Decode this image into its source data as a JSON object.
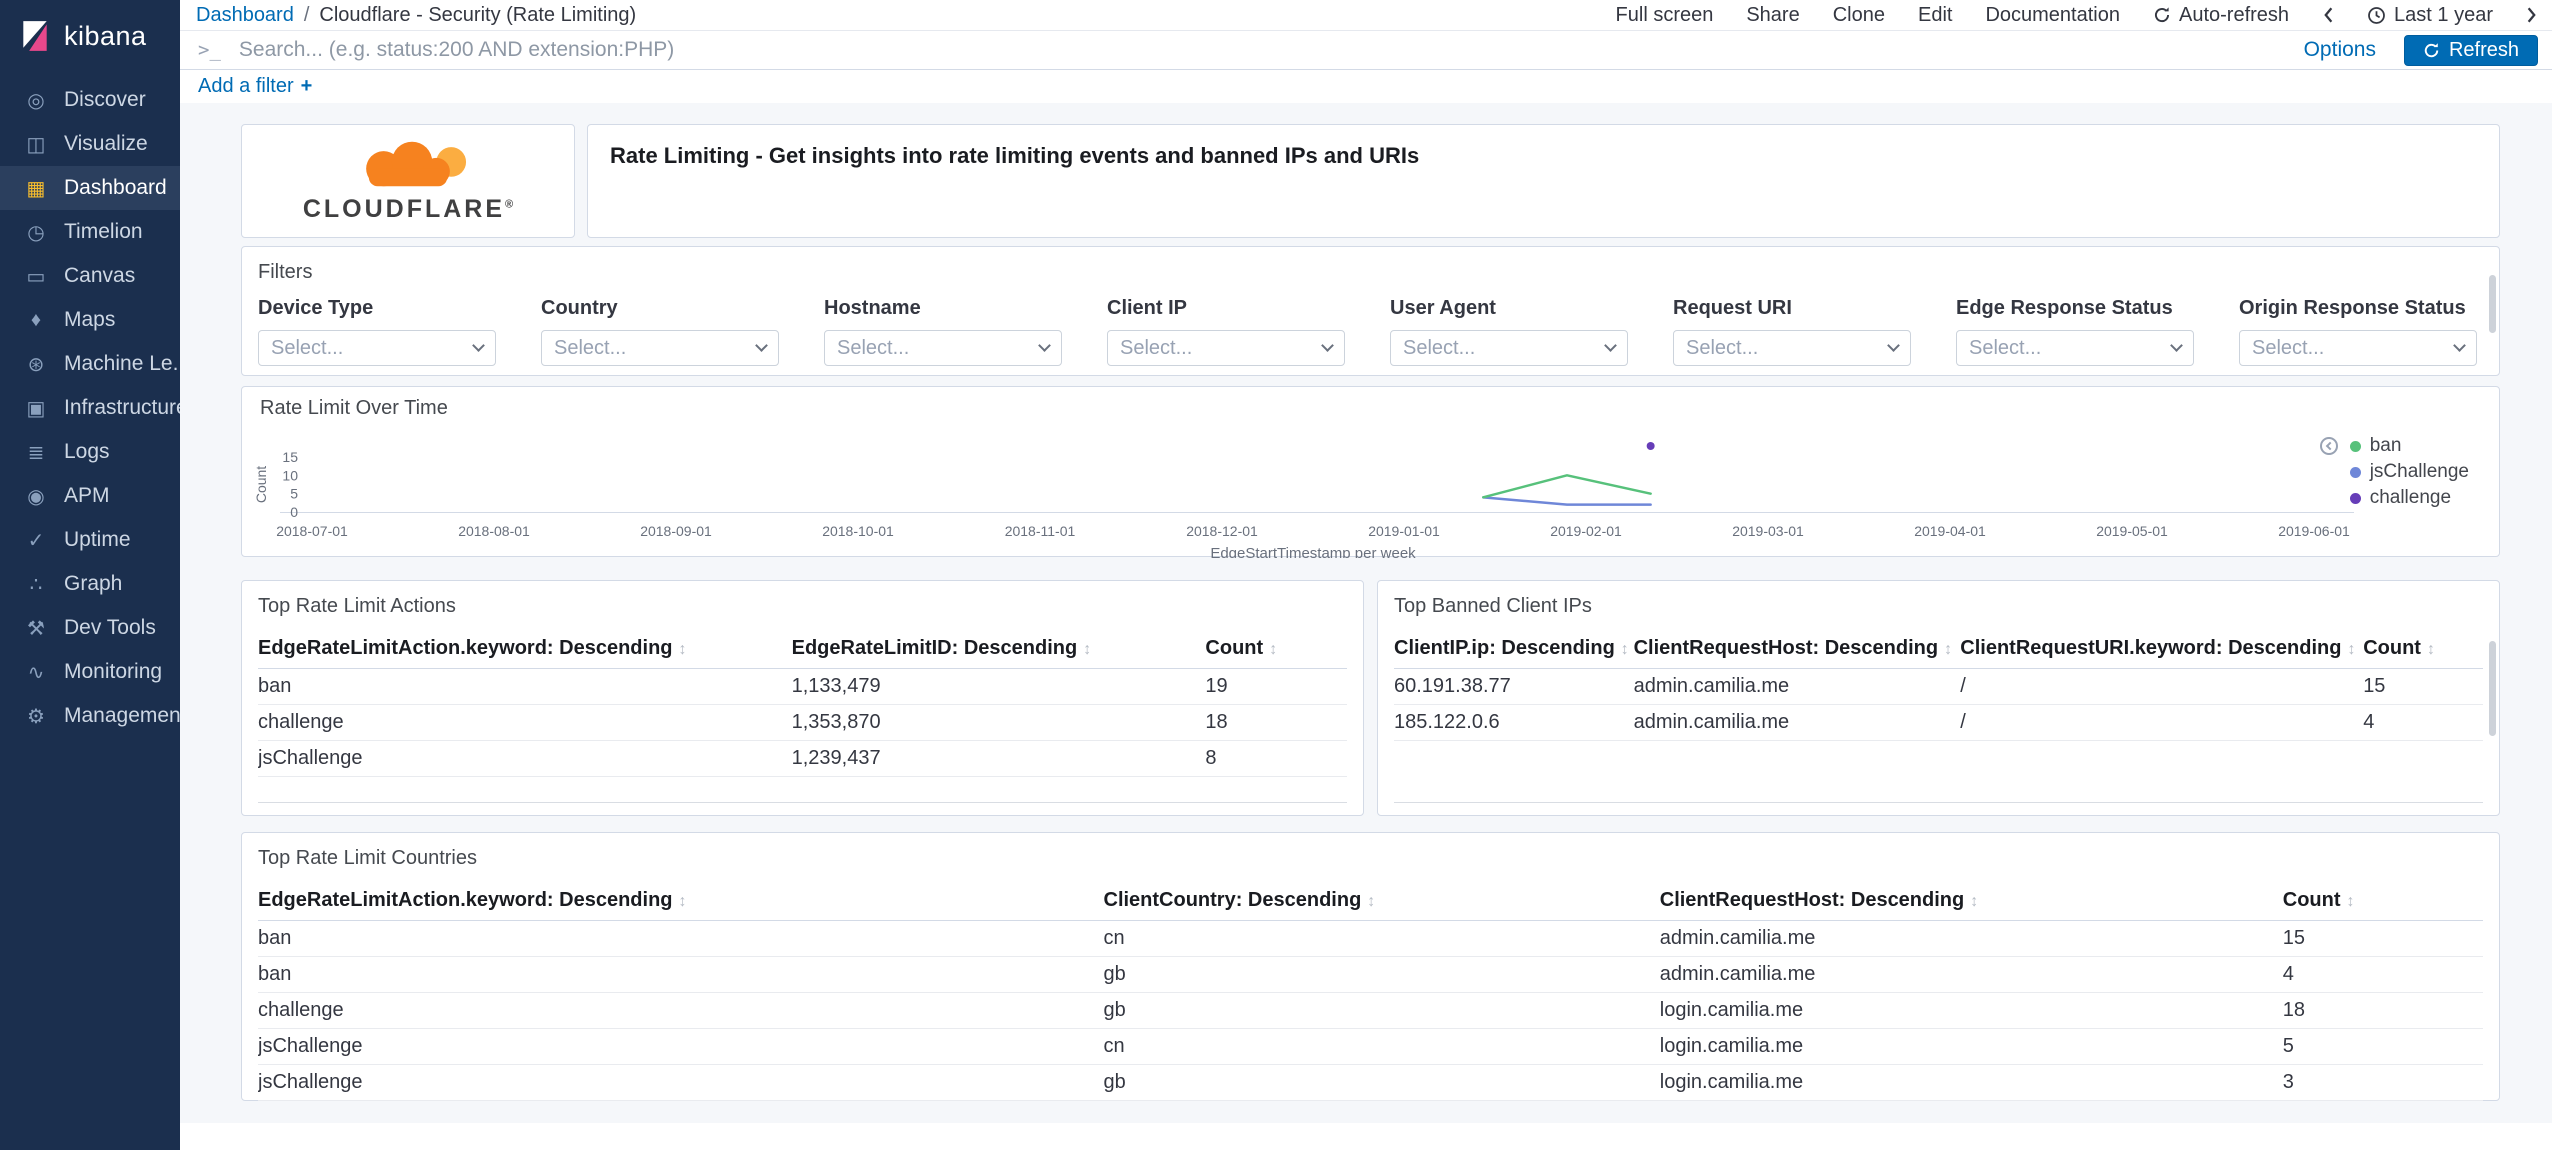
{
  "ui_colors": {
    "accent": "#006BB4",
    "sidebar_bg": "#1b2f4e",
    "active_icon": "#f5bc2e"
  },
  "sidebar": {
    "logo_text": "kibana",
    "items": [
      {
        "label": "Discover",
        "icon": "discover-icon",
        "active": false
      },
      {
        "label": "Visualize",
        "icon": "visualize-icon",
        "active": false
      },
      {
        "label": "Dashboard",
        "icon": "dashboard-icon",
        "active": true
      },
      {
        "label": "Timelion",
        "icon": "timelion-icon",
        "active": false
      },
      {
        "label": "Canvas",
        "icon": "canvas-icon",
        "active": false
      },
      {
        "label": "Maps",
        "icon": "maps-icon",
        "active": false
      },
      {
        "label": "Machine Le...",
        "icon": "machine-learning-icon",
        "active": false
      },
      {
        "label": "Infrastructure",
        "icon": "infrastructure-icon",
        "active": false
      },
      {
        "label": "Logs",
        "icon": "logs-icon",
        "active": false
      },
      {
        "label": "APM",
        "icon": "apm-icon",
        "active": false
      },
      {
        "label": "Uptime",
        "icon": "uptime-icon",
        "active": false
      },
      {
        "label": "Graph",
        "icon": "graph-icon",
        "active": false
      },
      {
        "label": "Dev Tools",
        "icon": "dev-tools-icon",
        "active": false
      },
      {
        "label": "Monitoring",
        "icon": "monitoring-icon",
        "active": false
      },
      {
        "label": "Management",
        "icon": "management-icon",
        "active": false
      }
    ]
  },
  "breadcrumb": {
    "root": "Dashboard",
    "separator": "/",
    "current": "Cloudflare - Security (Rate Limiting)"
  },
  "toolbar": {
    "full_screen": "Full screen",
    "share": "Share",
    "clone": "Clone",
    "edit": "Edit",
    "documentation": "Documentation",
    "auto_refresh": "Auto-refresh",
    "time_range": "Last 1 year"
  },
  "query_bar": {
    "prompt": ">_",
    "placeholder": "Search... (e.g. status:200 AND extension:PHP)",
    "options_label": "Options",
    "refresh_label": "Refresh"
  },
  "filter_bar": {
    "add_filter": "Add a filter",
    "plus": "+"
  },
  "cloudflare": {
    "brand": "CLOUDFLARE",
    "registered": "®"
  },
  "header_panel": {
    "title": "Rate Limiting - Get insights into rate limiting events and banned IPs and URIs"
  },
  "filters_panel": {
    "title": "Filters",
    "select_placeholder": "Select...",
    "fields": [
      "Device Type",
      "Country",
      "Hostname",
      "Client IP",
      "User Agent",
      "Request URI",
      "Edge Response Status",
      "Origin Response Status"
    ]
  },
  "chart_panel": {
    "title": "Rate Limit Over Time"
  },
  "chart_data": {
    "type": "line",
    "title": "Rate Limit Over Time",
    "xlabel": "EdgeStartTimestamp per week",
    "ylabel": "Count",
    "ylim": [
      0,
      15
    ],
    "y_ticks": [
      0,
      5,
      10,
      15
    ],
    "x_ticks": [
      "2018-07-01",
      "2018-08-01",
      "2018-09-01",
      "2018-10-01",
      "2018-11-01",
      "2018-12-01",
      "2019-01-01",
      "2019-02-01",
      "2019-03-01",
      "2019-04-01",
      "2019-05-01",
      "2019-06-01"
    ],
    "grid": false,
    "legend_position": "right",
    "series": [
      {
        "name": "ban",
        "color": "#57c17b",
        "points": [
          [
            "2019-01-13",
            4
          ],
          [
            "2019-01-27",
            10
          ],
          [
            "2019-02-10",
            5
          ]
        ]
      },
      {
        "name": "jsChallenge",
        "color": "#6f87d8",
        "points": [
          [
            "2019-01-13",
            4
          ],
          [
            "2019-01-27",
            2
          ],
          [
            "2019-02-10",
            2
          ]
        ]
      },
      {
        "name": "challenge",
        "color": "#663db8",
        "points": [
          [
            "2019-02-10",
            18
          ]
        ]
      }
    ]
  },
  "tables": {
    "actions": {
      "title": "Top Rate Limit Actions",
      "headers": [
        "EdgeRateLimitAction.keyword: Descending",
        "EdgeRateLimitID: Descending",
        "Count"
      ],
      "rows": [
        [
          "ban",
          "1,133,479",
          "19"
        ],
        [
          "challenge",
          "1,353,870",
          "18"
        ],
        [
          "jsChallenge",
          "1,239,437",
          "8"
        ]
      ]
    },
    "banned_ips": {
      "title": "Top Banned Client IPs",
      "headers": [
        "ClientIP.ip: Descending",
        "ClientRequestHost: Descending",
        "ClientRequestURI.keyword: Descending",
        "Count"
      ],
      "rows": [
        [
          "60.191.38.77",
          "admin.camilia.me",
          "/",
          "15"
        ],
        [
          "185.122.0.6",
          "admin.camilia.me",
          "/",
          "4"
        ]
      ]
    },
    "countries": {
      "title": "Top Rate Limit Countries",
      "headers": [
        "EdgeRateLimitAction.keyword: Descending",
        "ClientCountry: Descending",
        "ClientRequestHost: Descending",
        "Count"
      ],
      "rows": [
        [
          "ban",
          "cn",
          "admin.camilia.me",
          "15"
        ],
        [
          "ban",
          "gb",
          "admin.camilia.me",
          "4"
        ],
        [
          "challenge",
          "gb",
          "login.camilia.me",
          "18"
        ],
        [
          "jsChallenge",
          "cn",
          "login.camilia.me",
          "5"
        ],
        [
          "jsChallenge",
          "gb",
          "login.camilia.me",
          "3"
        ]
      ]
    }
  }
}
